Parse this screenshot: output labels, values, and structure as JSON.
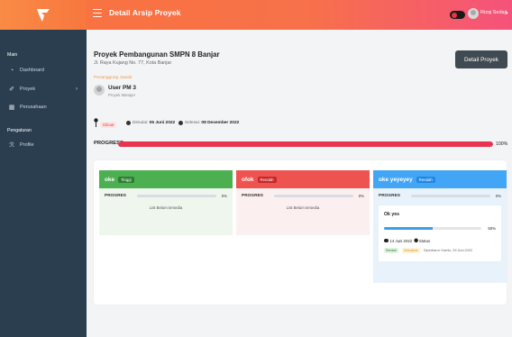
{
  "header": {
    "title": "Detail Arsip Proyek",
    "user_name": "Rizqi Sedaji"
  },
  "sidebar": {
    "section_main": "Main",
    "items_main": [
      {
        "label": "Dashboard",
        "icon": "dashboard-icon"
      },
      {
        "label": "Proyek",
        "icon": "project-icon"
      },
      {
        "label": "Perusahaan",
        "icon": "building-icon"
      }
    ],
    "section_settings": "Pengaturan",
    "items_settings": [
      {
        "label": "Profile",
        "icon": "profile-icon"
      }
    ]
  },
  "project": {
    "title": "Proyek Pembangunan SMPN 8 Banjar",
    "address": "Jl. Raya Kujang No. 77, Kota Banjar",
    "pj_label": "Penanggung Jawab",
    "pj_name": "User PM 3",
    "pj_role": "Proyek Manajer",
    "detail_button": "Detail Proyek",
    "status": "Dibuat",
    "start_label": "Dimulai:",
    "start_date": "06 Juni 2022",
    "end_label": "Selesai:",
    "end_date": "08 Desember 2022",
    "progress_label": "PROGRESS",
    "progress_pct": "100%",
    "progress_value": 1.0
  },
  "columns": [
    {
      "title": "oke",
      "tag": "Tinggi",
      "progress_label": "PROGRES",
      "progress_pct": "0%",
      "empty_text": "List Belum tersedia",
      "color": "#4caf50"
    },
    {
      "title": "ofok",
      "tag": "Rendah",
      "progress_label": "PROGRES",
      "progress_pct": "0%",
      "empty_text": "List Belum tersedia",
      "color": "#ef5350"
    },
    {
      "title": "oke yeyeyey",
      "tag": "Rendah",
      "progress_label": "PROGRES",
      "progress_pct": "0%",
      "color": "#42a5f5",
      "task": {
        "name": "Ok yes",
        "pct": "50%",
        "progress_value": 0.5,
        "date": "14 Juni 2022",
        "status_label": "Status",
        "tag1": "Rendah",
        "tag2": "Dikerjakan",
        "note": "Diperbarui: Kamis, 09 Juni 2022"
      }
    }
  ],
  "colors": {
    "header_start": "#f9733f",
    "header_end": "#f5527b",
    "sidebar": "#2b3e50",
    "progress": "#e8344f",
    "green": "#4caf50",
    "red": "#ef5350",
    "blue": "#42a5f5"
  }
}
